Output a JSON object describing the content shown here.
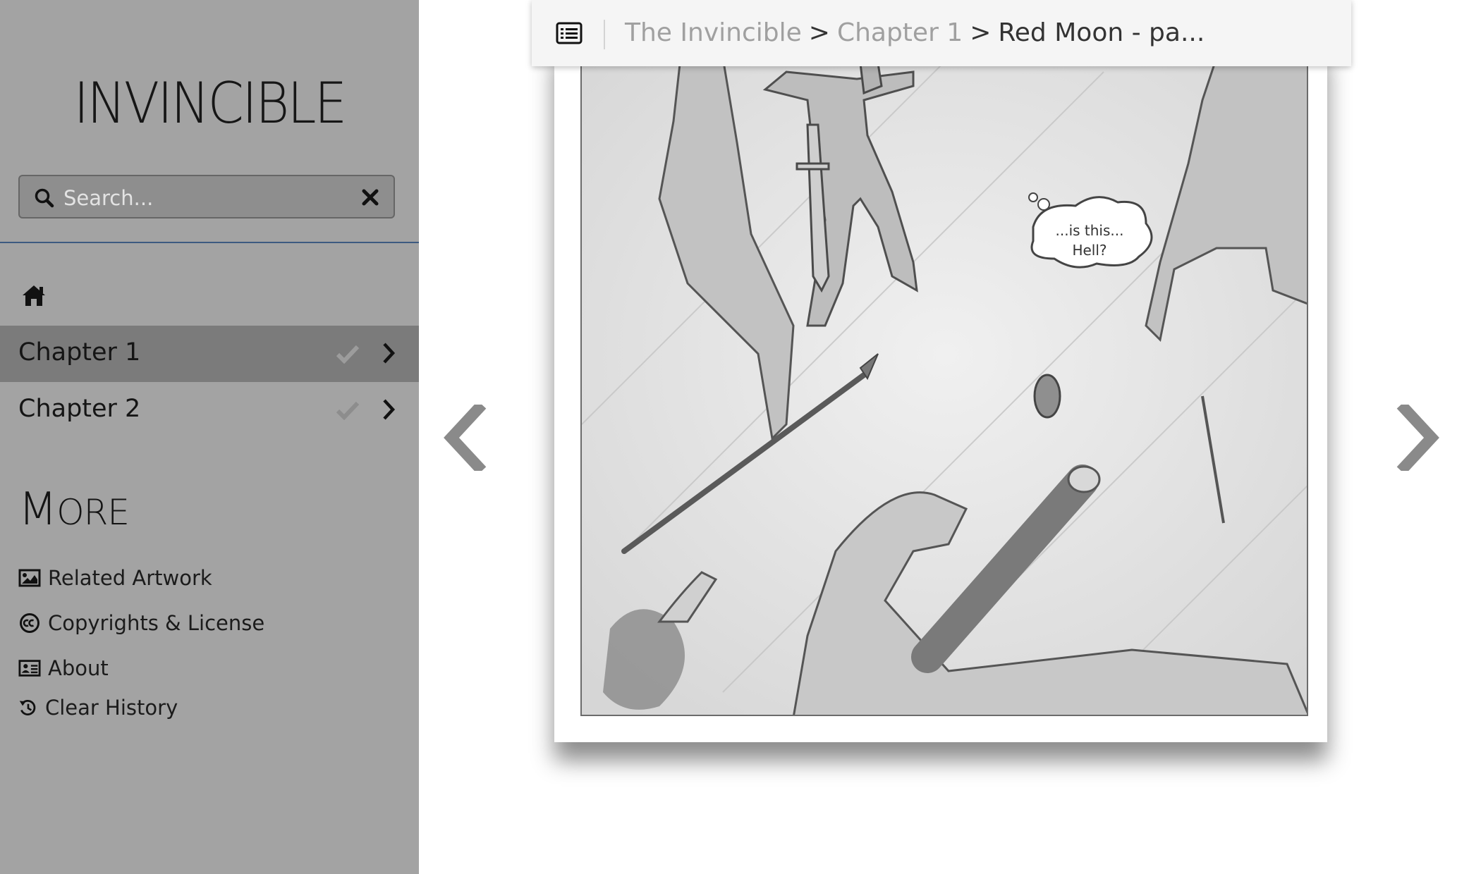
{
  "sidebar": {
    "site_title": "INVINCIBLE",
    "search": {
      "placeholder": "Search...",
      "value": ""
    },
    "chapters": [
      {
        "label": "Chapter 1",
        "active": true
      },
      {
        "label": "Chapter 2",
        "active": false
      }
    ],
    "more_title_first": "M",
    "more_title_rest": "ORE",
    "more_links": [
      {
        "label": "Related Artwork",
        "icon": "image-icon"
      },
      {
        "label": "Copyrights & License",
        "icon": "creative-commons-icon"
      },
      {
        "label": "About",
        "icon": "id-card-icon"
      },
      {
        "label": "Clear History",
        "icon": "history-icon"
      }
    ]
  },
  "breadcrumb": {
    "book": "The Invincible",
    "separator": ">",
    "chapter": "Chapter 1",
    "page": "Red Moon - pa..."
  },
  "comic": {
    "speech_bubble": "...is this...\nHell?",
    "bubble_line1": "...is this...",
    "bubble_line2": "Hell?"
  },
  "colors": {
    "sidebar_bg": "#a3a3a3",
    "active_chapter_bg": "#7b7b7b",
    "divider": "#3d5a80",
    "topbar_bg": "#f5f5f5"
  }
}
